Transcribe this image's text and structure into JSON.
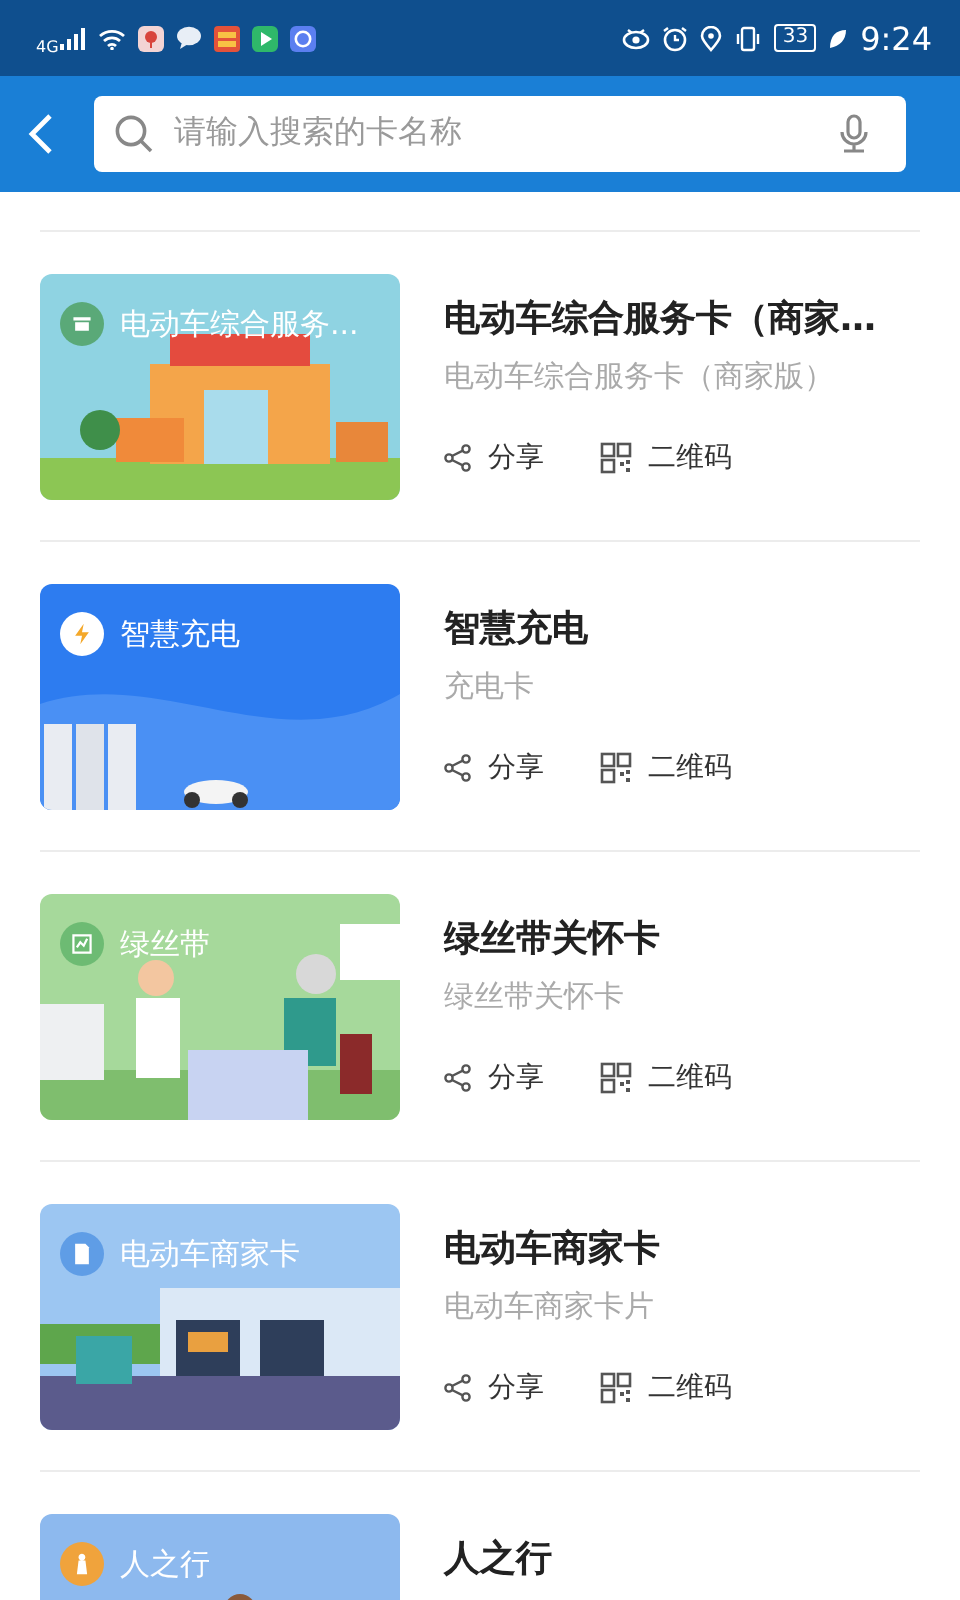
{
  "status_bar": {
    "network": "4G",
    "battery": "33",
    "time": "9:24"
  },
  "search": {
    "placeholder": "请输入搜索的卡名称"
  },
  "cards": [
    {
      "kind": "shop",
      "image_label": "电动车综合服务...",
      "title": "电动车综合服务卡（商家…",
      "subtitle": "电动车综合服务卡（商家版）",
      "actions": [
        {
          "kind": "share",
          "label": "分享"
        },
        {
          "kind": "qr",
          "label": "二维码"
        }
      ]
    },
    {
      "kind": "charge",
      "image_label": "智慧充电",
      "title": "智慧充电",
      "subtitle": "充电卡",
      "actions": [
        {
          "kind": "share",
          "label": "分享"
        },
        {
          "kind": "qr",
          "label": "二维码"
        }
      ]
    },
    {
      "kind": "care",
      "image_label": "绿丝带",
      "title": "绿丝带关怀卡",
      "subtitle": "绿丝带关怀卡",
      "actions": [
        {
          "kind": "share",
          "label": "分享"
        },
        {
          "kind": "qr",
          "label": "二维码"
        }
      ]
    },
    {
      "kind": "merchant",
      "image_label": "电动车商家卡",
      "title": "电动车商家卡",
      "subtitle": "电动车商家卡片",
      "actions": [
        {
          "kind": "share",
          "label": "分享"
        },
        {
          "kind": "qr",
          "label": "二维码"
        }
      ]
    },
    {
      "kind": "walk",
      "image_label": "人之行",
      "title": "人之行"
    }
  ]
}
